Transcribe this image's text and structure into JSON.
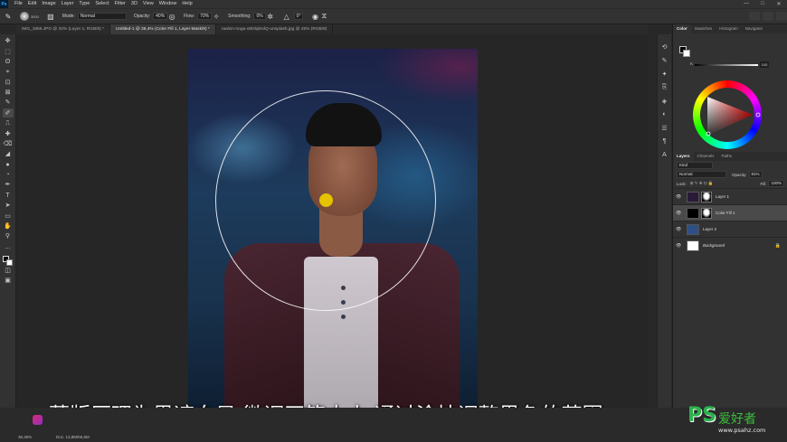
{
  "app": {
    "logo": "Ps"
  },
  "menu": [
    "File",
    "Edit",
    "Image",
    "Layer",
    "Type",
    "Select",
    "Filter",
    "3D",
    "View",
    "Window",
    "Help"
  ],
  "window_controls": [
    "—",
    "□",
    "✕"
  ],
  "options": {
    "brush_size": "3000",
    "mode_label": "Mode:",
    "mode_value": "Normal",
    "opacity_label": "Opacity:",
    "opacity_value": "40%",
    "flow_label": "Flow:",
    "flow_value": "70%",
    "smoothing_label": "Smoothing:",
    "smoothing_value": "0%",
    "angle_value": "0°"
  },
  "tabs": [
    {
      "label": "IMG_1855.JPG @ 32% (Layer 1, RGB/8) *",
      "active": false
    },
    {
      "label": "Untitled-1 @ 36,4% (Color Fill 1, Layer Mask/8) *",
      "active": true
    },
    {
      "label": "rawkm-noga-o8l4lqkIolQ-unsplash.jpg @ 25% (RGB/8)",
      "active": false
    }
  ],
  "tools": [
    "✥",
    "⬚",
    "ʘ",
    "⌖",
    "⊡",
    "⊠",
    "✎",
    "✐",
    "⎍",
    "✚",
    "⌫",
    "◢",
    "●",
    "◔",
    "✒",
    "T",
    "➤",
    "▭",
    "✋",
    "⚲",
    "…"
  ],
  "subtitle": "蒙版原理为黑遮白显 微调画笔大小 通过涂抹调整黑色的范围",
  "status": {
    "zoom": "36,36%",
    "doc": "Doc: 13,8M/66,6M"
  },
  "color_panel": {
    "tabs": [
      "Color",
      "Swatches",
      "Histogram",
      "Navigator"
    ],
    "channel": "K",
    "value": "100"
  },
  "layers_panel": {
    "tabs": [
      "Layers",
      "Channels",
      "Paths"
    ],
    "filter_kind": "Kind",
    "blend_mode": "Normal",
    "opacity_label": "Opacity:",
    "opacity_value": "81%",
    "lock_label": "Lock:",
    "fill_label": "Fill:",
    "fill_value": "100%",
    "layers": [
      {
        "name": "Layer 1",
        "selected": false,
        "thumb": "#2a1a3a",
        "has_mask": true,
        "locked": false,
        "italic": false
      },
      {
        "name": "Color Fill 1",
        "selected": true,
        "thumb": "#000000",
        "has_mask": true,
        "locked": false,
        "italic": false
      },
      {
        "name": "Layer 2",
        "selected": false,
        "thumb": "#2d4f86",
        "has_mask": false,
        "locked": false,
        "italic": false
      },
      {
        "name": "Background",
        "selected": false,
        "thumb": "#ffffff",
        "has_mask": false,
        "locked": true,
        "italic": true
      }
    ]
  },
  "watermark": {
    "logo": "PS",
    "text": "爱好者",
    "url": "www.psahz.com"
  }
}
